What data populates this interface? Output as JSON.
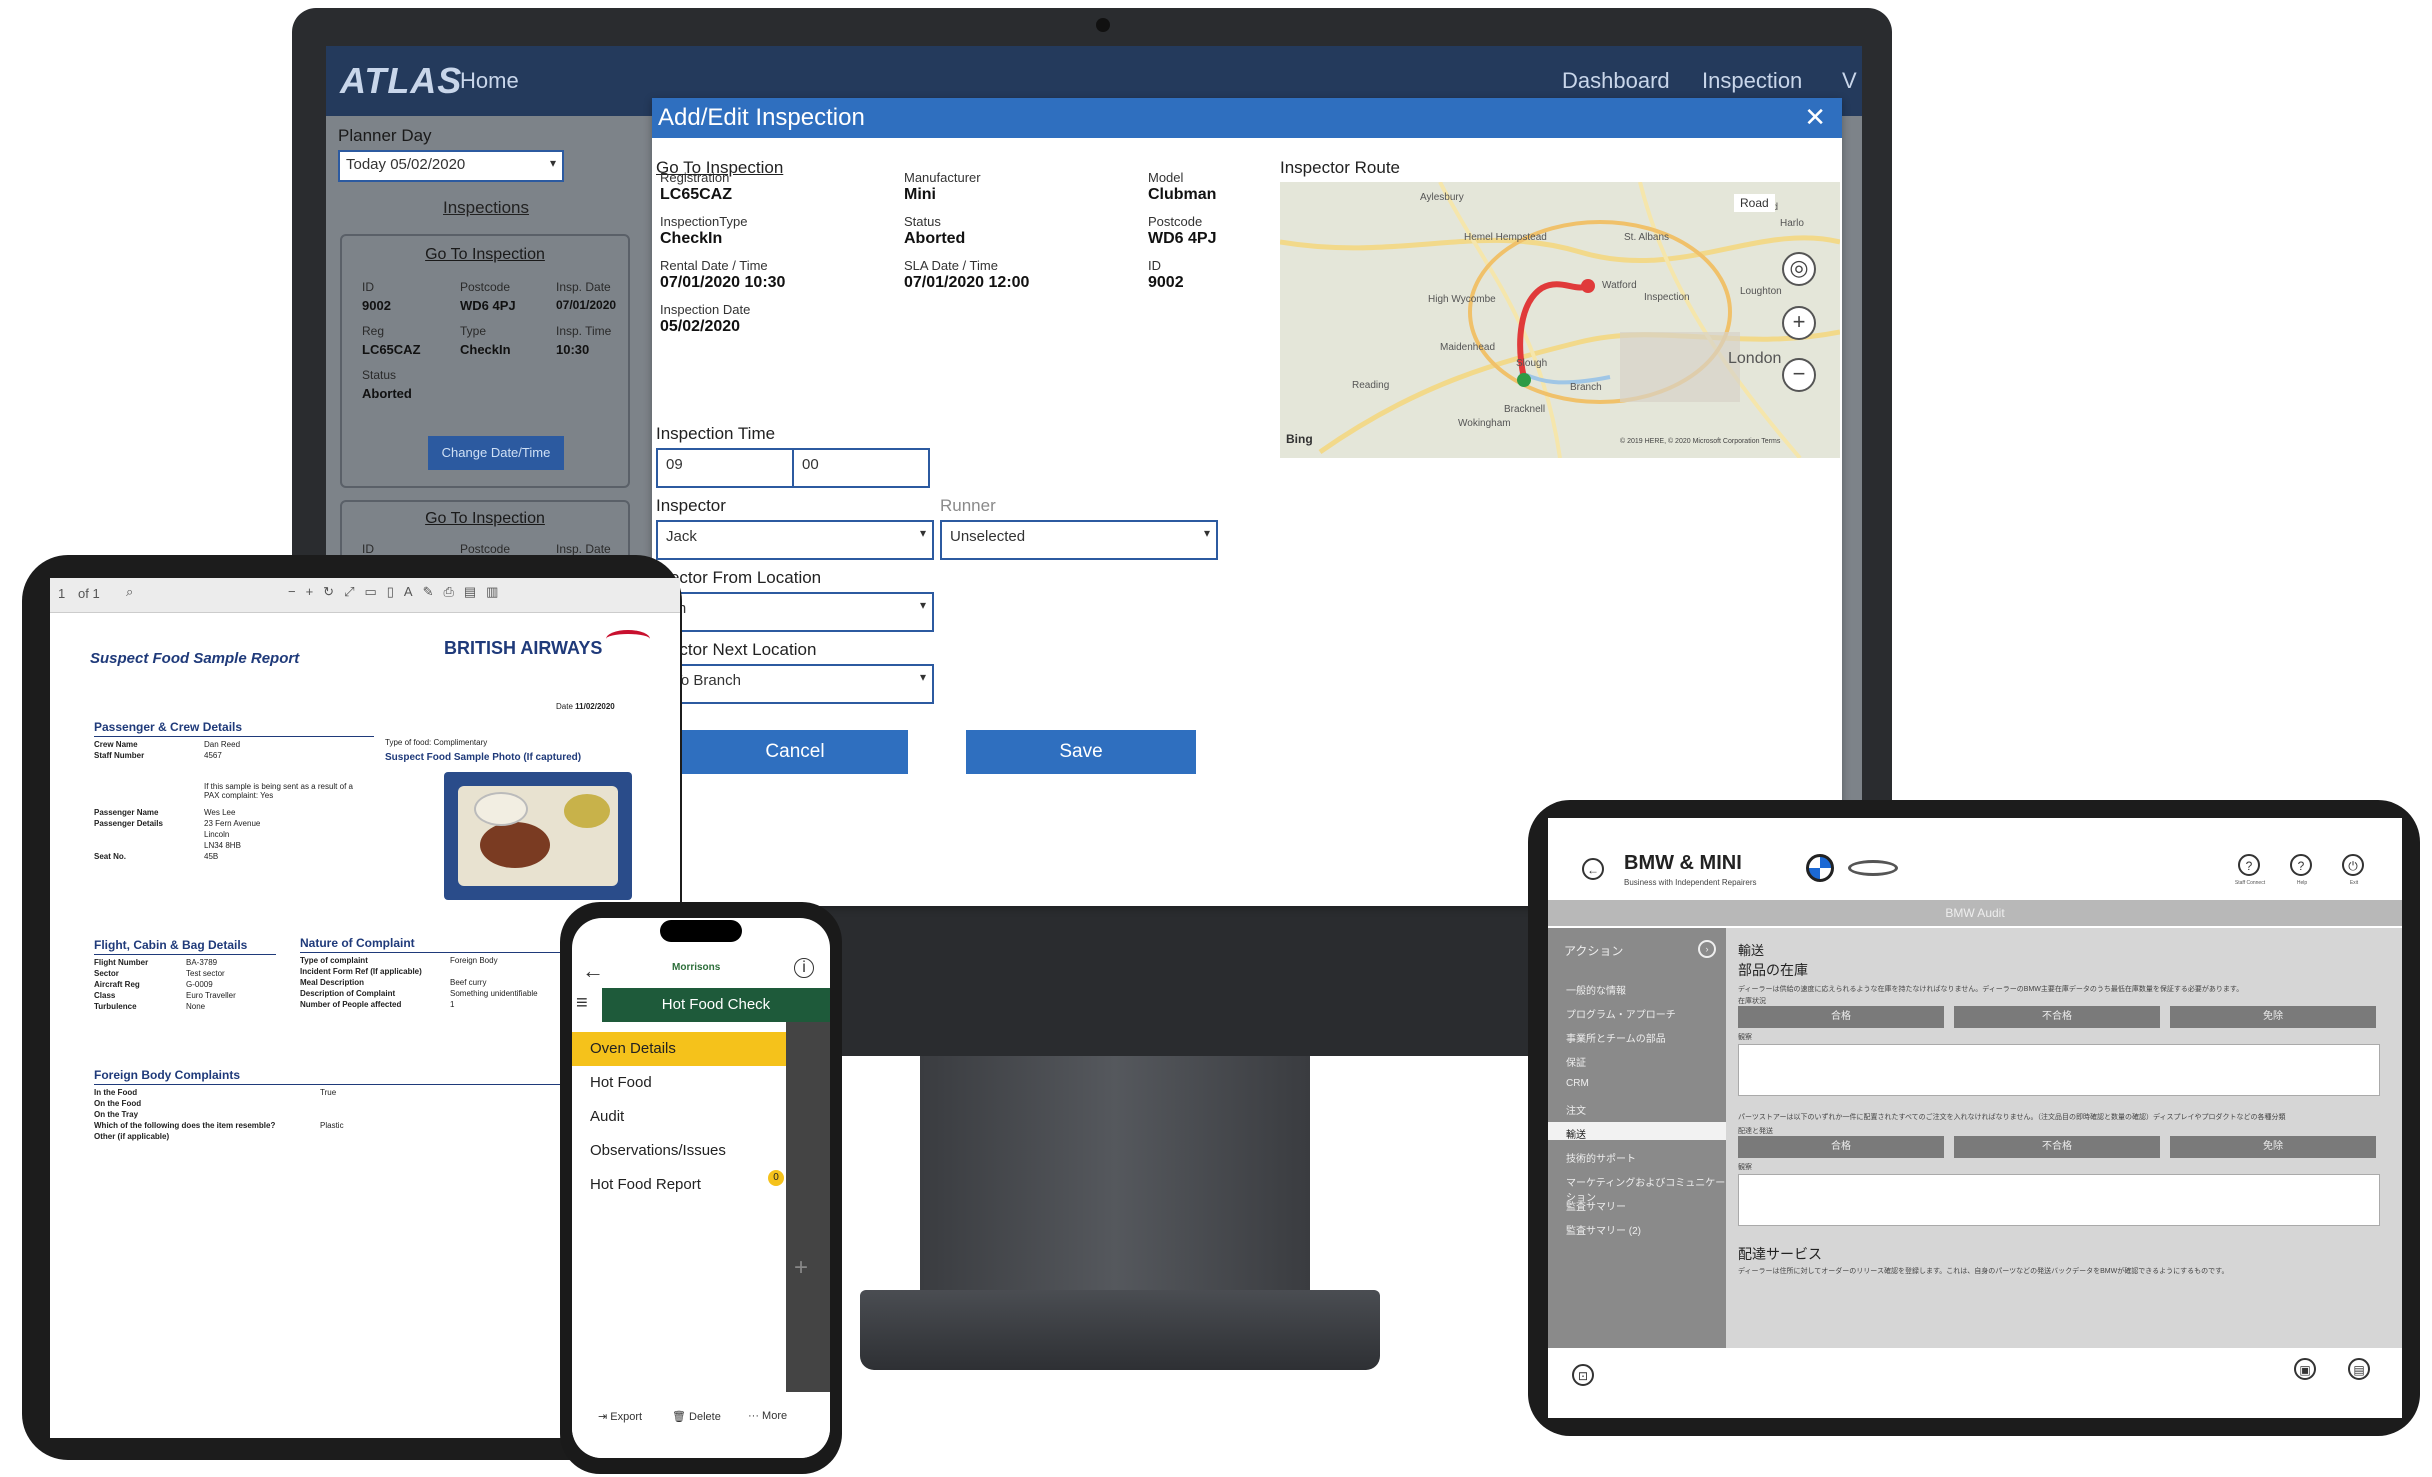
{
  "monitor": {
    "app": {
      "logo": "ATLAS",
      "nav": {
        "home": "Home",
        "dashboard": "Dashboard",
        "inspection": "Inspection",
        "more": "V"
      }
    },
    "sidebar": {
      "planner_day_label": "Planner Day",
      "planner_day_value": "Today 05/02/2020",
      "inspections_link": "Inspections",
      "card1": {
        "link": "Go To Inspection",
        "id_label": "ID",
        "id_value": "9002",
        "postcode_label": "Postcode",
        "postcode_value": "WD6 4PJ",
        "insp_date_label": "Insp. Date",
        "insp_date_value": "07/01/2020",
        "reg_label": "Reg",
        "reg_value": "LC65CAZ",
        "type_label": "Type",
        "type_value": "CheckIn",
        "insp_time_label": "Insp. Time",
        "insp_time_value": "10:30",
        "status_label": "Status",
        "status_value": "Aborted",
        "button": "Change Date/Time"
      },
      "card2": {
        "link": "Go To Inspection",
        "id_label": "ID",
        "postcode_label": "Postcode",
        "insp_date_label": "Insp. Date"
      }
    },
    "modal": {
      "title": "Add/Edit Inspection",
      "close": "✕",
      "go_to_link": "Go To Inspection",
      "fields": [
        {
          "label": "Registration",
          "value": "LC65CAZ"
        },
        {
          "label": "Manufacturer",
          "value": "Mini"
        },
        {
          "label": "Model",
          "value": "Clubman"
        },
        {
          "label": "InspectionType",
          "value": "CheckIn"
        },
        {
          "label": "Status",
          "value": "Aborted"
        },
        {
          "label": "Postcode",
          "value": "WD6 4PJ"
        },
        {
          "label": "Rental Date / Time",
          "value": "07/01/2020 10:30"
        },
        {
          "label": "SLA Date / Time",
          "value": "07/01/2020 12:00"
        },
        {
          "label": "ID",
          "value": "9002"
        },
        {
          "label": "Inspection Date",
          "value": "05/02/2020"
        }
      ],
      "inspection_time_label": "Inspection Time",
      "hour": "09",
      "minute": "00",
      "inspector_label": "Inspector",
      "inspector_value": "Jack",
      "runner_label": "Runner",
      "runner_value": "Unselected",
      "from_location_label": "spector From Location",
      "from_location_value": "nch",
      "next_location_label": "spector Next Location",
      "next_location_value": "k To Branch",
      "cancel": "Cancel",
      "save": "Save",
      "map": {
        "title": "Inspector Route",
        "road": "Road",
        "places": [
          "Aylesbury",
          "Hertford",
          "Harlo",
          "Hemel Hempstead",
          "St. Albans",
          "Watford",
          "Inspection",
          "Loughton",
          "High Wycombe",
          "Maidenhead",
          "Slough",
          "London",
          "Branch",
          "Reading",
          "Bracknell",
          "Wokingham"
        ],
        "bing": "Bing",
        "copyright": "© 2019 HERE, © 2020 Microsoft Corporation Terms"
      }
    }
  },
  "tablet_left": {
    "toolbar": {
      "page": "1",
      "of": "of 1"
    },
    "report_title": "Suspect Food Sample Report",
    "airline": "BRITISH AIRWAYS",
    "date_label": "Date",
    "date_value": "11/02/2020",
    "crew_section": "Passenger & Crew Details",
    "crew_rows": [
      {
        "k": "Crew Name",
        "v": "Dan Reed"
      },
      {
        "k": "Staff Number",
        "v": "4567"
      }
    ],
    "type_food": "Type of food: Complimentary",
    "photo_title": "Suspect Food Sample Photo (If captured)",
    "pax_note": "If this sample is being sent as a result of a PAX complaint: Yes",
    "pax_rows": [
      {
        "k": "Passenger Name",
        "v": "Wes Lee"
      },
      {
        "k": "Passenger Details",
        "v": "23 Fern Avenue"
      },
      {
        "k": "",
        "v": "Lincoln"
      },
      {
        "k": "",
        "v": "LN34 8HB"
      },
      {
        "k": "Seat No.",
        "v": "45B"
      }
    ],
    "flight_section": "Flight, Cabin & Bag Details",
    "flight_rows": [
      {
        "k": "Flight Number",
        "v": "BA-3789"
      },
      {
        "k": "Sector",
        "v": "Test sector"
      },
      {
        "k": "Aircraft Reg",
        "v": "G-0009"
      },
      {
        "k": "Class",
        "v": "Euro Traveller"
      },
      {
        "k": "Turbulence",
        "v": "None"
      }
    ],
    "complaint_section": "Nature of Complaint",
    "complaint_rows": [
      {
        "k": "Type of complaint",
        "v": "Foreign Body"
      },
      {
        "k": "Incident Form Ref (If applicable)",
        "v": ""
      },
      {
        "k": "Meal Description",
        "v": "Beef curry"
      },
      {
        "k": "Description of Complaint",
        "v": "Something unidentifiable"
      },
      {
        "k": "Number of People affected",
        "v": "1"
      }
    ],
    "foreign_section": "Foreign Body Complaints",
    "foreign_rows": [
      {
        "k": "In the Food",
        "v": "True"
      },
      {
        "k": "On the Food",
        "v": ""
      },
      {
        "k": "On the Tray",
        "v": ""
      },
      {
        "k": "Which of the following does the item resemble?",
        "v": "Plastic"
      },
      {
        "k": "Other (if applicable)",
        "v": ""
      }
    ]
  },
  "phone": {
    "brand": "Morrisons",
    "header": "Hot Food Check",
    "menu": [
      "Oven Details",
      "Hot Food",
      "Audit",
      "Observations/Issues",
      "Hot Food Report"
    ],
    "badge": "0",
    "actions": {
      "export": "Export",
      "delete": "Delete",
      "more": "More"
    }
  },
  "tablet_right": {
    "title": "BMW & MINI",
    "subtitle": "Business with Independent Repairers",
    "header_icons": [
      "Staff Connect",
      "Help",
      "Exit"
    ],
    "section_bar": "BMW Audit",
    "sidebar_title": "アクション",
    "sidebar_items": [
      "一般的な情報",
      "プログラム・アプローチ",
      "事業所とチームの部品",
      "保証",
      "CRM",
      "注文",
      "輸送",
      "技術的サポート",
      "マーケティングおよびコミュニケーション",
      "監査サマリー",
      "監査サマリー (2)"
    ],
    "active_item": "輸送",
    "main_heading": "輸送",
    "main_sub": "部品の在庫",
    "desc1": "ディーラーは供給の速度に応えられるような在庫を持たなければなりません。ディーラーのBMW主要在庫データのうち最低在庫数量を保証する必要があります。",
    "status_label": "在庫状況",
    "buttons": [
      "合格",
      "不合格",
      "免除"
    ],
    "comment_label": "観察",
    "desc2": "パーツストアーは以下のいずれか一件に配置されたすべてのご注文を入れなければなりません。（注文品目の即時確認と数量の確認）ディスプレイやプロダクトなどの各種分類",
    "delivery_label": "配達と発送",
    "buttons2": [
      "合格",
      "不合格",
      "免除"
    ],
    "comment_label2": "観察",
    "section3": "配達サービス",
    "desc3": "ディーラーは住所に対してオーダーのリリース確認を登録します。これは、自身のパーツなどの発送バックデータをBMWが確認できるようにするものです。"
  }
}
